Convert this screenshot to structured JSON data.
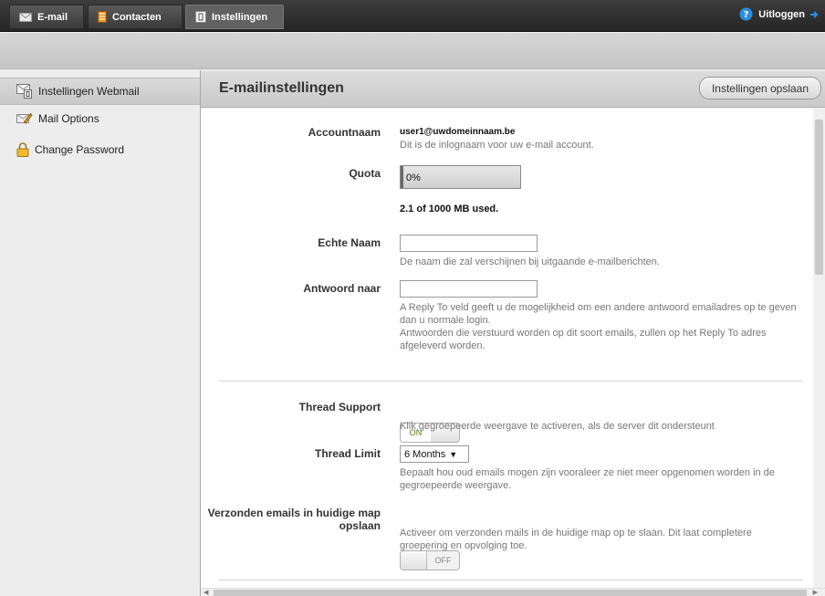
{
  "topbar": {
    "tabs": [
      {
        "label": "E-mail",
        "icon": "envelope-icon"
      },
      {
        "label": "Contacten",
        "icon": "address-book-icon"
      },
      {
        "label": "Instellingen",
        "icon": "settings-icon"
      }
    ],
    "logout_label": "Uitloggen"
  },
  "sidebar": {
    "items": [
      {
        "label": "Instellingen Webmail",
        "icon": "webmail-settings-icon"
      },
      {
        "label": "Mail Options",
        "icon": "mail-options-icon"
      },
      {
        "label": "Change Password",
        "icon": "lock-icon"
      }
    ]
  },
  "main": {
    "title": "E-mailinstellingen",
    "save_label": "Instellingen opslaan"
  },
  "form": {
    "account": {
      "label": "Accountnaam",
      "value": "user1@uwdomeinnaam.be",
      "help": "Dit is de inlognaam voor uw e-mail account."
    },
    "quota": {
      "label": "Quota",
      "percent_text": "0%",
      "fraction": 0.0021,
      "used_text": "2.1 of 1000 MB used."
    },
    "real_name": {
      "label": "Echte Naam",
      "value": "",
      "help": "De naam die zal verschijnen bij uitgaande e-mailberichten."
    },
    "reply_to": {
      "label": "Antwoord naar",
      "value": "",
      "help1": "A Reply To veld geeft u de mogelijkheid om een andere antwoord emailadres op te geven dan u normale login.",
      "help2": "Antwoorden die verstuurd worden op dit soort emails, zullen op het Reply To adres afgeleverd worden."
    },
    "thread_support": {
      "label": "Thread Support",
      "state": "ON",
      "help": "Klik gegroepeerde weergave te activeren, als de server dit ondersteunt"
    },
    "thread_limit": {
      "label": "Thread Limit",
      "value": "6 Months",
      "help": "Bepaalt hou oud emails mogen zijn vooraleer ze niet meer opgenomen worden in de gegroepeerde weergave."
    },
    "sent_in_folder": {
      "label": "Verzonden emails in huidige map opslaan",
      "state": "OFF",
      "help": "Activeer om verzonden mails in de huidige map op te slaan. Dit laat completere groepering en opvolging toe."
    }
  },
  "colors": {
    "topbar": "#2e2e2e",
    "on_text": "#4d7a13",
    "accent_logout": "#2b8de0"
  }
}
